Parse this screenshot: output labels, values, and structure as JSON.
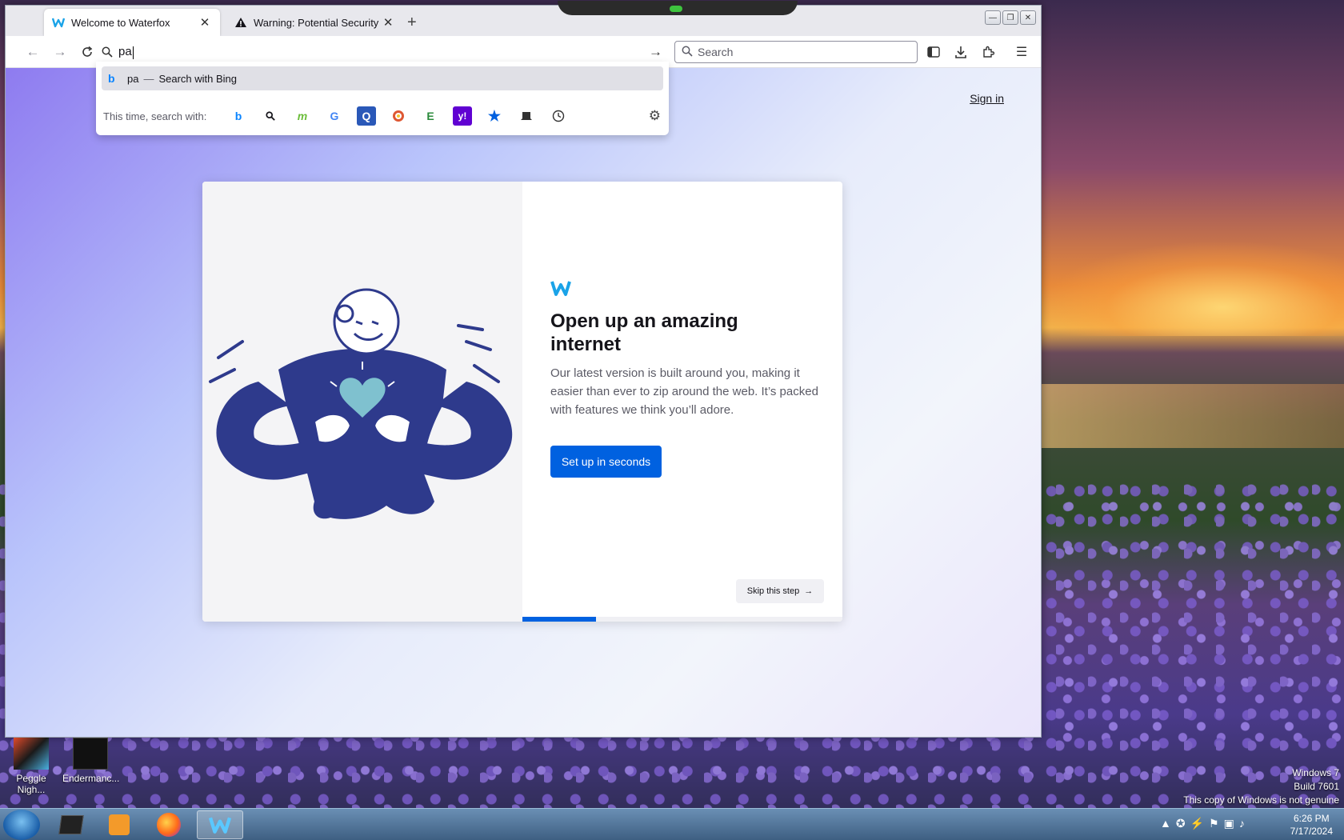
{
  "browser": {
    "tabs": [
      {
        "label": "Welcome to Waterfox",
        "active": true,
        "icon": "waterfox-icon"
      },
      {
        "label": "Warning: Potential Security Risk",
        "active": false,
        "icon": "warning-icon"
      }
    ],
    "url_input": "pa",
    "search_placeholder": "Search",
    "dropdown": {
      "suggestion_query": "pa",
      "suggestion_separator": "—",
      "suggestion_action": "Search with Bing",
      "oneoff_label": "This time, search with:",
      "engines": [
        "bing",
        "search",
        "m",
        "G",
        "Q",
        "duckduckgo",
        "E",
        "yahoo",
        "bookmarks",
        "tabs",
        "history"
      ]
    }
  },
  "page": {
    "signin": "Sign in",
    "title": "Open up an amazing internet",
    "body": "Our latest version is built around you, making it easier than ever to zip around the web. It’s packed with features we think you’ll adore.",
    "cta": "Set up in seconds",
    "skip": "Skip this step",
    "progress": 0.23
  },
  "desktop": {
    "icons": [
      {
        "label": "Peggle Nigh..."
      },
      {
        "label": "Endermanc..."
      }
    ],
    "watermark": [
      "Windows 7",
      "Build 7601",
      "This copy of Windows is not genuine"
    ]
  },
  "taskbar": {
    "time": "6:26 PM",
    "date": "7/17/2024"
  },
  "colors": {
    "accent": "#0061e0",
    "illustration": "#2e3a8c",
    "heart": "#7fc1cf"
  }
}
